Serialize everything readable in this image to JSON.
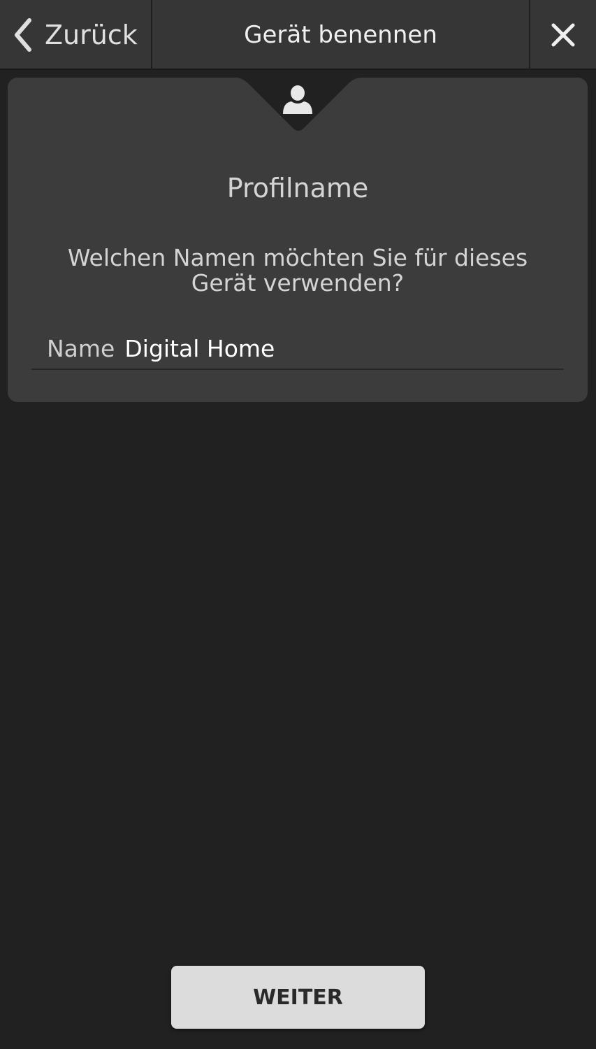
{
  "topbar": {
    "back_label": "Zurück",
    "title": "Gerät benennen",
    "back_icon": "chevron-left-icon",
    "close_icon": "close-icon"
  },
  "card": {
    "icon": "person-icon",
    "heading": "Profilname",
    "question": "Welchen Namen möchten Sie für dieses Gerät verwenden?",
    "field": {
      "label": "Name",
      "value": "Digital Home"
    }
  },
  "footer": {
    "next_label": "WEITER"
  },
  "colors": {
    "background": "#212121",
    "topbar": "#363636",
    "card": "#3c3c3c",
    "button": "#dcdcdc"
  }
}
